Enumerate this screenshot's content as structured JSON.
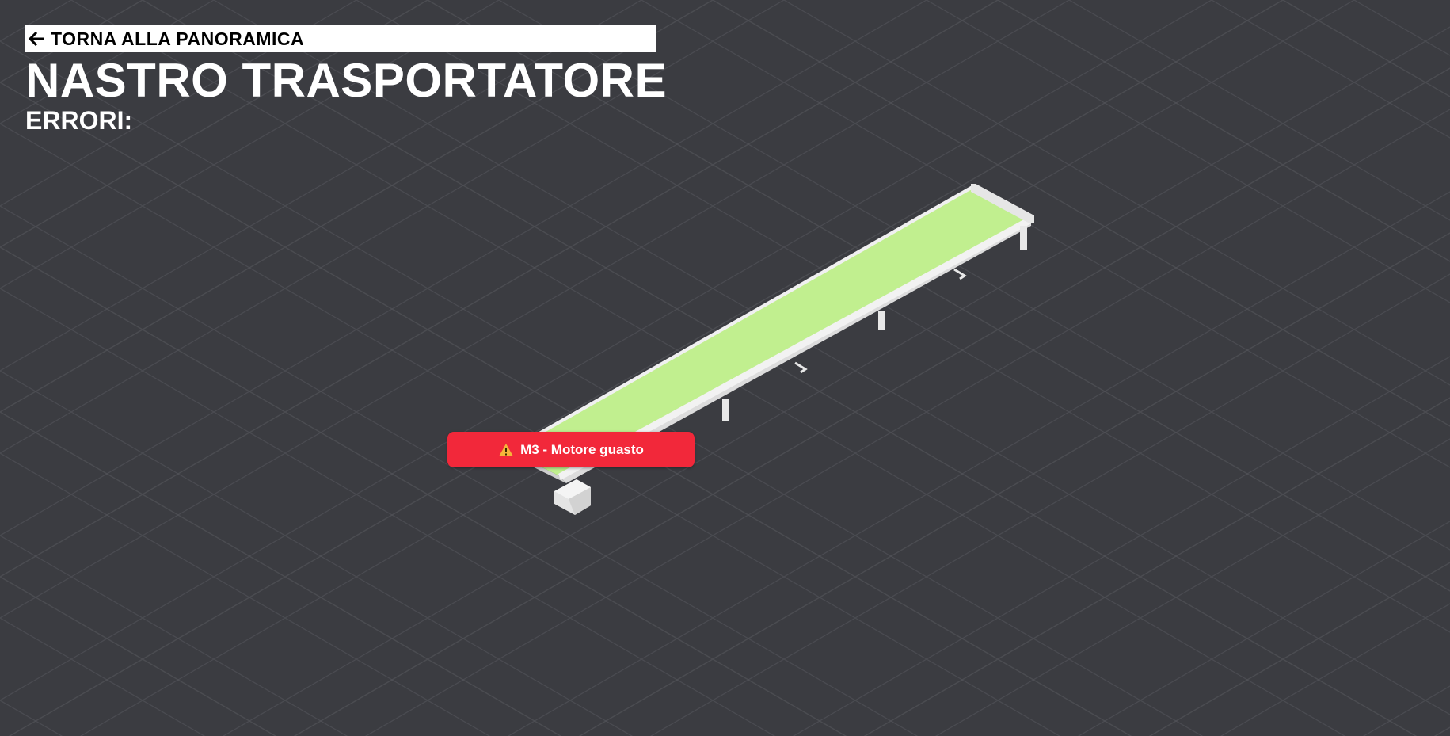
{
  "header": {
    "back_label": "TORNA ALLA PANORAMICA",
    "back_icon": "arrow-left-icon",
    "title": "NASTRO TRASPORTATORE",
    "errors_label": "ERRORI:"
  },
  "scene": {
    "background_color": "#3b3c41",
    "tile_line_color": "#55565c",
    "belt_color": "#c1ef8f",
    "frame_color": "#eeeeee",
    "errors": [
      {
        "text": "M3 - Motore guasto",
        "icon": "warning-icon",
        "color": "#f2283a"
      }
    ]
  }
}
